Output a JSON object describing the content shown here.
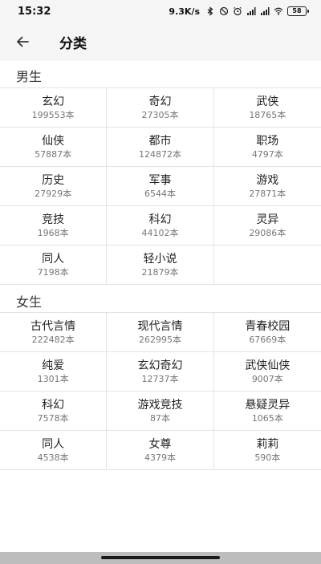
{
  "status_bar": {
    "time": "15:32",
    "net_speed": "9.3K/s",
    "battery": "58",
    "icons": [
      "bluetooth-icon",
      "do-not-disturb-icon",
      "alarm-icon",
      "signal-icon",
      "signal-icon",
      "wifi-icon",
      "battery-icon"
    ]
  },
  "header": {
    "back_icon": "arrow-left-icon",
    "title": "分类"
  },
  "male": {
    "title": "男生",
    "rows": [
      [
        {
          "name": "玄幻",
          "count": "199553本"
        },
        {
          "name": "奇幻",
          "count": "27305本"
        },
        {
          "name": "武侠",
          "count": "18765本"
        }
      ],
      [
        {
          "name": "仙侠",
          "count": "57887本"
        },
        {
          "name": "都市",
          "count": "124872本"
        },
        {
          "name": "职场",
          "count": "4797本"
        }
      ],
      [
        {
          "name": "历史",
          "count": "27929本"
        },
        {
          "name": "军事",
          "count": "6544本"
        },
        {
          "name": "游戏",
          "count": "27871本"
        }
      ],
      [
        {
          "name": "竞技",
          "count": "1968本"
        },
        {
          "name": "科幻",
          "count": "44102本"
        },
        {
          "name": "灵异",
          "count": "29086本"
        }
      ],
      [
        {
          "name": "同人",
          "count": "7198本"
        },
        {
          "name": "轻小说",
          "count": "21879本"
        }
      ]
    ]
  },
  "female": {
    "title": "女生",
    "rows": [
      [
        {
          "name": "古代言情",
          "count": "222482本"
        },
        {
          "name": "现代言情",
          "count": "262995本"
        },
        {
          "name": "青春校园",
          "count": "67669本"
        }
      ],
      [
        {
          "name": "纯爱",
          "count": "1301本"
        },
        {
          "name": "玄幻奇幻",
          "count": "12737本"
        },
        {
          "name": "武侠仙侠",
          "count": "9007本"
        }
      ],
      [
        {
          "name": "科幻",
          "count": "7578本"
        },
        {
          "name": "游戏竞技",
          "count": "87本"
        },
        {
          "name": "悬疑灵异",
          "count": "1065本"
        }
      ],
      [
        {
          "name": "同人",
          "count": "4538本"
        },
        {
          "name": "女尊",
          "count": "4379本"
        },
        {
          "name": "莉莉",
          "count": "590本"
        }
      ]
    ]
  }
}
